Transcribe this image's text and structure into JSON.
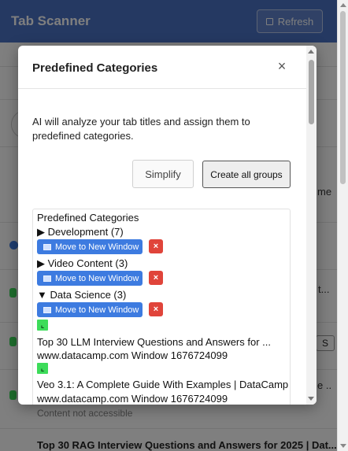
{
  "app": {
    "title": "Tab Scanner",
    "refresh_label": "Refresh"
  },
  "background": {
    "fragments": [
      "me",
      "t...",
      "S",
      "e ..",
      "Content not accessible",
      "Top 30 RAG Interview Questions and Answers for 2025 | Dat..."
    ]
  },
  "modal": {
    "title": "Predefined Categories",
    "close_label": "×",
    "description": "AI will analyze your tab titles and assign them to predefined categories.",
    "simplify_label": "Simplify",
    "create_all_label": "Create all groups",
    "list_heading": "Predefined Categories",
    "move_label": "Move to New Window",
    "delete_label": "×",
    "categories": [
      {
        "label": "▶ Development (7)"
      },
      {
        "label": "▶ Video Content (3)"
      },
      {
        "label": "▼ Data Science (3)"
      }
    ],
    "tabs": [
      {
        "title": "Top 30 LLM Interview Questions and Answers for ...",
        "meta": "www.datacamp.com Window 1676724099"
      },
      {
        "title": "Veo 3.1: A Complete Guide With Examples | DataCamp",
        "meta": "www.datacamp.com Window 1676724099"
      }
    ],
    "favicon_glyph": "⌞"
  },
  "colors": {
    "header": "#4a72c5",
    "move_button": "#3d7be0",
    "delete_button": "#e0443a",
    "favicon": "#3ddc5a"
  }
}
